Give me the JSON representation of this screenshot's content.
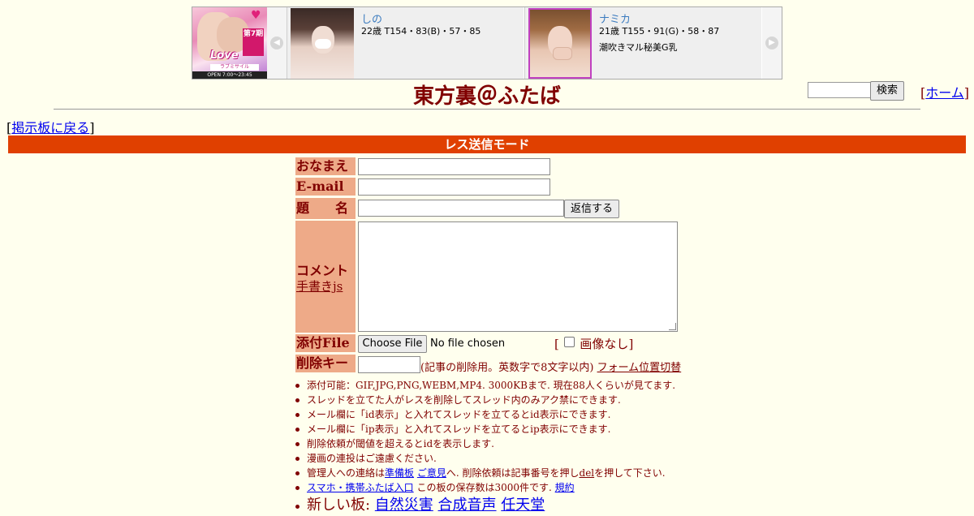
{
  "banner": {
    "ad": {
      "badge": "第7期",
      "logo": "Love",
      "subtitle": "ラブミサイル",
      "footer": "OPEN 7:00〜23:45"
    },
    "cards": [
      {
        "name": "しの",
        "stats": "22歳 T154・83(B)・57・85",
        "comment": ""
      },
      {
        "name": "ナミカ",
        "stats": "21歳 T155・91(G)・58・87",
        "comment": "潮吹きマル秘美G乳"
      }
    ],
    "prev_icon": "chevron-left-icon",
    "next_icon": "chevron-right-icon"
  },
  "header": {
    "title": "東方裏＠ふたば",
    "search_button": "検索",
    "home_link": "ホーム",
    "home_open": "[",
    "home_close": "]"
  },
  "back": {
    "open": "[",
    "link": "掲示板に戻る",
    "close": "]"
  },
  "mode_bar": "レス送信モード",
  "form": {
    "name_label": "おなまえ",
    "email_label": "E-mail",
    "subject_label": "題　　名",
    "submit_button": "返信する",
    "comment_label": "コメント",
    "tegaki_link": "手書きjs",
    "file_label": "添付File",
    "choose_file_button": "Choose File",
    "no_file_text": "No file chosen",
    "no_image_open": "[",
    "no_image_label": "画像なし",
    "no_image_close": "]",
    "no_image_checked": false,
    "delkey_label": "削除キー",
    "delkey_hint": "(記事の削除用。英数字で8文字以内)",
    "form_switch_link": "フォーム位置切替"
  },
  "rules": {
    "line1": "添付可能：GIF,JPG,PNG,WEBM,MP4. 3000KBまで. 現在88人くらいが見てます.",
    "line2": "スレッドを立てた人がレスを削除してスレッド内のみアク禁にできます.",
    "line3": "メール欄に「id表示」と入れてスレッドを立てるとid表示にできます.",
    "line4": "メール欄に「ip表示」と入れてスレッドを立てるとip表示にできます.",
    "line5": "削除依頼が閾値を超えるとidを表示します.",
    "line6": "漫画の連投はご遠慮ください.",
    "line7_prefix": "管理人への連絡は",
    "line7_link1": "準備板",
    "line7_link2": "ご意見",
    "line7_mid": "へ. 削除依頼は記事番号を押し",
    "line7_link3": "del",
    "line7_suffix": "を押して下さい.",
    "line8_link1": "スマホ・携帯ふたば入口",
    "line8_mid": " この板の保存数は3000件です. ",
    "line8_link2": "規約",
    "line9_prefix": "新しい板: ",
    "line9_link1": "自然災害",
    "line9_link2": "合成音声",
    "line9_link3": "任天堂"
  }
}
